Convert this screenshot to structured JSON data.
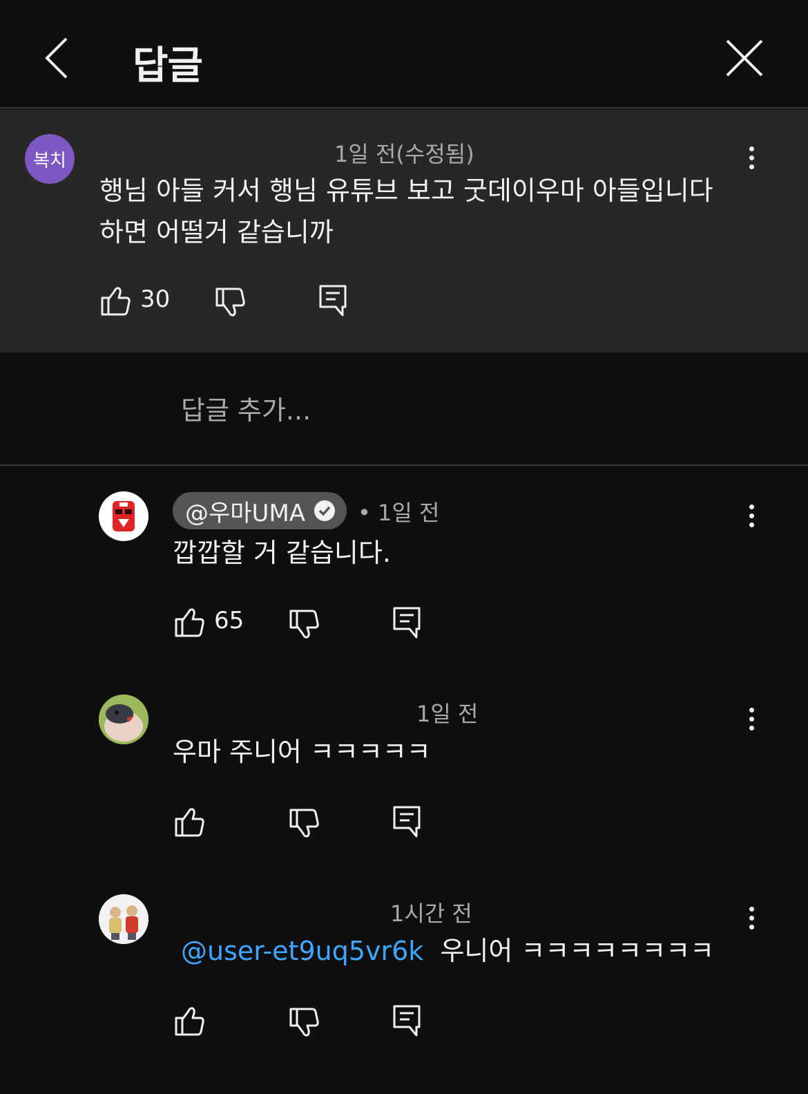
{
  "header": {
    "title": "답글"
  },
  "parent_comment": {
    "avatar_text": "복치",
    "avatar_color": "#7e57c2",
    "time": "1일 전(수정됨)",
    "text_line1": "행님 아들 커서 행님 유튜브 보고 굿데이우마 아들입니다",
    "text_line2": "하면  어떨거 같습니까",
    "likes": "30"
  },
  "add_reply": {
    "placeholder": "답글 추가..."
  },
  "replies": [
    {
      "author": "@우마UMA",
      "verified": true,
      "time": "• 1일 전",
      "text": "깝깝할 거 같습니다.",
      "likes": "65"
    },
    {
      "time": "1일 전",
      "text": "우마 주니어 ㅋㅋㅋㅋㅋ",
      "likes": ""
    },
    {
      "time": "1시간 전",
      "mention": "@user-et9uq5vr6k",
      "text": "우니어 ㅋㅋㅋㅋㅋㅋㅋㅋ",
      "likes": ""
    }
  ],
  "colors": {
    "background": "#0f0f0f",
    "parent_bg": "#272727",
    "link": "#3ea6ff"
  },
  "icons": [
    "back-icon",
    "close-icon",
    "more-icon",
    "thumbs-up-icon",
    "thumbs-down-icon",
    "reply-icon",
    "verified-icon"
  ]
}
